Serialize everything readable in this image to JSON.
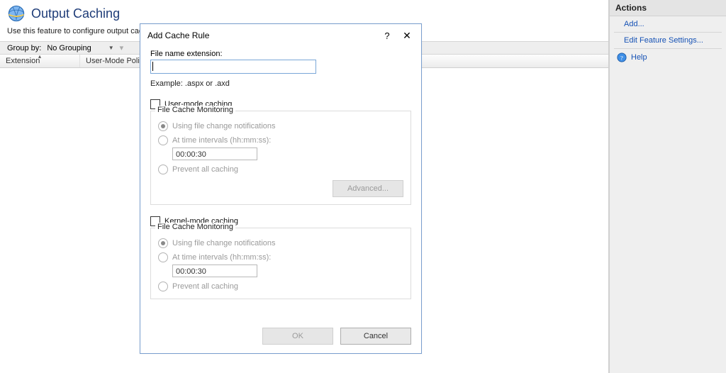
{
  "page": {
    "title": "Output Caching",
    "description": "Use this feature to configure output cache s",
    "group_by_label": "Group by:",
    "group_by_value": "No Grouping"
  },
  "list": {
    "columns": {
      "extension": "Extension",
      "user_mode": "User-Mode Policy"
    }
  },
  "dialog": {
    "title": "Add Cache Rule",
    "ext_label": "File name extension:",
    "ext_value": "",
    "example": "Example: .aspx or .axd",
    "user_mode": {
      "checkbox_label": "User-mode caching",
      "group_title": "File Cache Monitoring",
      "radio_notify": "Using file change notifications",
      "radio_interval": "At time intervals (hh:mm:ss):",
      "interval_value": "00:00:30",
      "radio_prevent": "Prevent all caching",
      "advanced_button": "Advanced..."
    },
    "kernel_mode": {
      "checkbox_label": "Kernel-mode caching",
      "group_title": "File Cache Monitoring",
      "radio_notify": "Using file change notifications",
      "radio_interval": "At time intervals (hh:mm:ss):",
      "interval_value": "00:00:30",
      "radio_prevent": "Prevent all caching"
    },
    "buttons": {
      "ok": "OK",
      "cancel": "Cancel"
    }
  },
  "actions": {
    "title": "Actions",
    "add": "Add...",
    "edit_settings": "Edit Feature Settings...",
    "help": "Help"
  }
}
